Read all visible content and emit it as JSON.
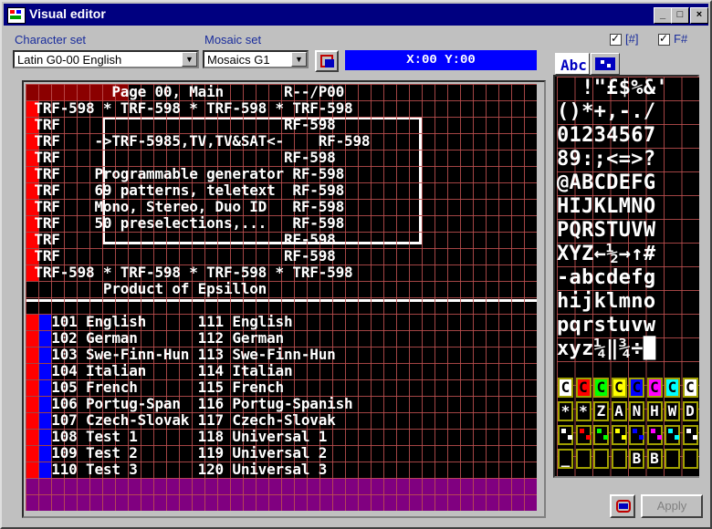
{
  "window": {
    "title": "Visual editor"
  },
  "titlebar_buttons": [
    "_",
    "□",
    "×"
  ],
  "character_set": {
    "label": "Character set",
    "value": "Latin G0-00 English"
  },
  "mosaic_set": {
    "label": "Mosaic set",
    "value": "Mosaics G1"
  },
  "coordinates": "X:00 Y:00",
  "checkboxes": [
    {
      "label": "[#]",
      "checked": true
    },
    {
      "label": "F#",
      "checked": true
    }
  ],
  "tabs": [
    {
      "label": "Abc"
    },
    {
      "label": "mosaic"
    }
  ],
  "teletext_rows": [
    "          Page 00, Main       R--/P00",
    " TRF-598 * TRF-598 * TRF-598 * TRF-598",
    " TRF                          RF-598",
    " TRF    ->TRF-5985,TV,TV&SAT<-    RF-598",
    " TRF                          RF-598",
    " TRF    Programmable generator RF-598",
    " TRF    69 patterns, teletext  RF-598",
    " TRF    Mono, Stereo, Duo ID   RF-598",
    " TRF    50 preselections,...   RF-598",
    " TRF                          RF-598",
    " TRF                          RF-598",
    " TRF-598 * TRF-598 * TRF-598 * TRF-598",
    "         Product of Epsillon",
    "",
    "   101 English      111 English",
    "   102 German       112 German",
    "   103 Swe-Finn-Hun 113 Swe-Finn-Hun",
    "   104 Italian      114 Italian",
    "   105 French       115 French",
    "   106 Portug-Span  116 Portug-Spanish",
    "   107 Czech-Slovak 117 Czech-Slovak",
    "   108 Test 1       118 Universal 1",
    "   109 Test 2       119 Universal 2",
    "   110 Test 3       120 Universal 3"
  ],
  "charset_rows": [
    "  !\"£$%&'",
    "()*+,-./",
    "01234567",
    "89:;<=>?",
    "@ABCDEFG",
    "HIJKLMNO",
    "PQRSTUVW",
    "XYZ←½→↑#",
    "-abcdefg",
    "hijklmno",
    "pqrstuvw",
    "xyz¼‖¾÷█"
  ],
  "control_codes": [
    "C",
    "C",
    "C",
    "C",
    "C",
    "C",
    "C",
    "C"
  ],
  "control_code_colors": [
    "#ffffff",
    "#ff0000",
    "#00ff00",
    "#ffff00",
    "#0000ff",
    "#ff00ff",
    "#00ffff",
    "#ffffff"
  ],
  "control_row2": [
    "*",
    "*",
    "Z",
    "A",
    "N",
    "H",
    "W",
    "D"
  ],
  "control_row3_colors": [
    "#ffffff",
    "#ff0000",
    "#00ff00",
    "#ffff00",
    "#0000ff",
    "#ff00ff",
    "#00ffff",
    "#ffffff"
  ],
  "control_row4": [
    "_",
    "",
    "",
    "",
    "B",
    "B",
    "",
    ""
  ],
  "apply_button": "Apply",
  "colors": {
    "title_bar": "#000080",
    "coord_bg": "#0000ff",
    "footer_magenta": "#800080"
  }
}
